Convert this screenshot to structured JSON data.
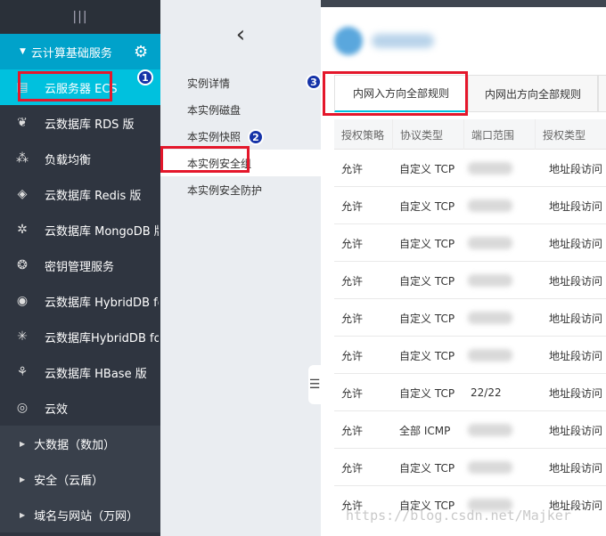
{
  "sidebar": {
    "collapse_icon": "grip-icon",
    "section": {
      "label": "云计算基础服务",
      "settings_icon": "gear-icon"
    },
    "items": [
      {
        "label": "云服务器 ECS",
        "icon": "server-icon"
      },
      {
        "label": "云数据库 RDS 版",
        "icon": "db-icon"
      },
      {
        "label": "负载均衡",
        "icon": "balance-icon"
      },
      {
        "label": "云数据库 Redis 版",
        "icon": "layers-icon"
      },
      {
        "label": "云数据库 MongoDB 版",
        "icon": "gear-outline-icon"
      },
      {
        "label": "密钥管理服务",
        "icon": "key-icon"
      },
      {
        "label": "云数据库 HybridDB fo...",
        "icon": "eye-icon"
      },
      {
        "label": "云数据库HybridDB for...",
        "icon": "network-icon"
      },
      {
        "label": "云数据库 HBase 版",
        "icon": "tree-icon"
      },
      {
        "label": "云效",
        "icon": "eye-icon"
      }
    ],
    "groups": [
      {
        "label": "大数据（数加）"
      },
      {
        "label": "安全（云盾）"
      },
      {
        "label": "域名与网站（万网）"
      }
    ]
  },
  "subnav": {
    "back_icon": "chevron-left-icon",
    "items": [
      {
        "label": "实例详情"
      },
      {
        "label": "本实例磁盘"
      },
      {
        "label": "本实例快照"
      },
      {
        "label": "本实例安全组"
      },
      {
        "label": "本实例安全防护"
      }
    ]
  },
  "main": {
    "tabs": [
      {
        "label": "内网入方向全部规则"
      },
      {
        "label": "内网出方向全部规则"
      },
      {
        "label": "安"
      }
    ],
    "columns": [
      "授权策略",
      "协议类型",
      "端口范围",
      "授权类型"
    ],
    "rows": [
      {
        "policy": "允许",
        "protocol": "自定义 TCP",
        "port": "",
        "auth": "地址段访问"
      },
      {
        "policy": "允许",
        "protocol": "自定义 TCP",
        "port": "",
        "auth": "地址段访问"
      },
      {
        "policy": "允许",
        "protocol": "自定义 TCP",
        "port": "",
        "auth": "地址段访问"
      },
      {
        "policy": "允许",
        "protocol": "自定义 TCP",
        "port": "",
        "auth": "地址段访问"
      },
      {
        "policy": "允许",
        "protocol": "自定义 TCP",
        "port": "",
        "auth": "地址段访问"
      },
      {
        "policy": "允许",
        "protocol": "自定义 TCP",
        "port": "",
        "auth": "地址段访问"
      },
      {
        "policy": "允许",
        "protocol": "自定义 TCP",
        "port": "22/22",
        "auth": "地址段访问"
      },
      {
        "policy": "允许",
        "protocol": "全部 ICMP",
        "port": "",
        "auth": "地址段访问"
      },
      {
        "policy": "允许",
        "protocol": "自定义 TCP",
        "port": "",
        "auth": "地址段访问"
      },
      {
        "policy": "允许",
        "protocol": "自定义 TCP",
        "port": "",
        "auth": "地址段访问"
      }
    ]
  },
  "annotations": {
    "badge1": "1",
    "badge2": "2",
    "badge3": "3"
  },
  "watermark": "https://blog.csdn.net/Majker",
  "colors": {
    "sidebar_bg": "#2f3540",
    "accent": "#00c1de",
    "section": "#00a2ca",
    "highlight": "#e4172b",
    "badge": "#1533a8"
  }
}
